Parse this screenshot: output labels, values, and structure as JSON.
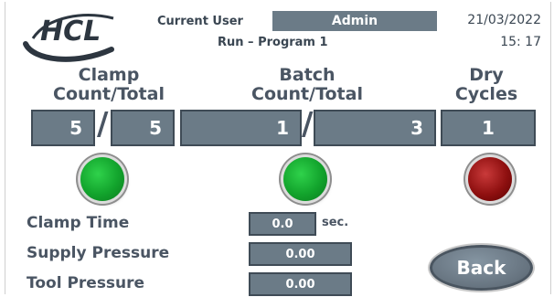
{
  "header": {
    "current_user_label": "Current User",
    "current_user": "Admin",
    "program": "Run – Program 1",
    "date": "21/03/2022",
    "time": "15: 17",
    "logo_text": "HCL"
  },
  "columns": {
    "clamp": {
      "title_line1": "Clamp",
      "title_line2": "Count/Total",
      "count": "5",
      "total": "5",
      "lamp": "green"
    },
    "batch": {
      "title_line1": "Batch",
      "title_line2": "Count/Total",
      "count": "1",
      "total": "3",
      "lamp": "green"
    },
    "dry": {
      "title_line1": "Dry",
      "title_line2": "Cycles",
      "value": "1",
      "lamp": "red"
    }
  },
  "separator": "/",
  "params": {
    "clamp_time": {
      "label": "Clamp Time",
      "value": "0.0",
      "unit": "sec."
    },
    "supply_pressure": {
      "label": "Supply Pressure",
      "value": "0.00"
    },
    "tool_pressure": {
      "label": "Tool Pressure",
      "value": "0.00"
    }
  },
  "back_label": "Back",
  "colors": {
    "field_bg": "#6b7b87",
    "text": "#4a5563",
    "lamp_green": "#12a32c",
    "lamp_red": "#8f1010"
  }
}
